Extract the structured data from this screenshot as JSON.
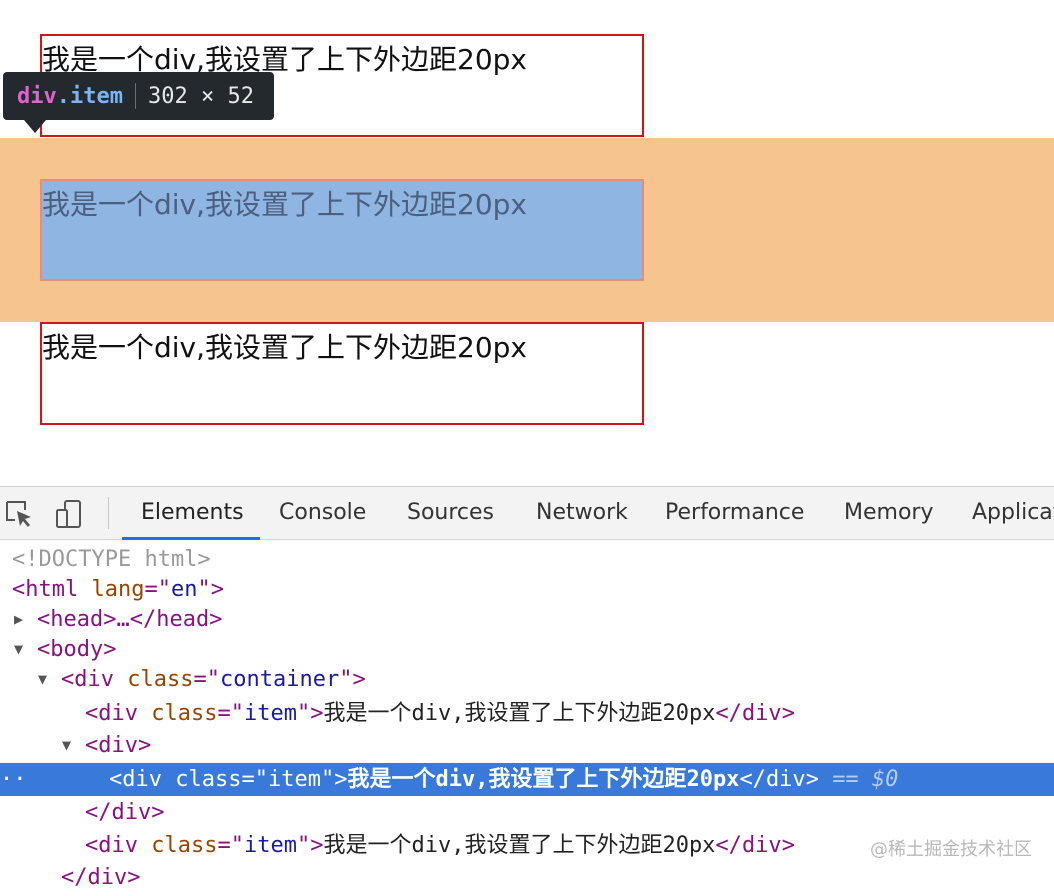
{
  "page": {
    "item_text": "我是一个div,我设置了上下外边距20px",
    "tooltip": {
      "tag": "div",
      "class": ".item",
      "size": "302 × 52"
    }
  },
  "devtools": {
    "tabs": [
      "Elements",
      "Console",
      "Sources",
      "Network",
      "Performance",
      "Memory",
      "Applicat"
    ],
    "active_tab": "Elements",
    "icons": [
      "inspect-element-icon",
      "device-toggle-icon"
    ],
    "dom": {
      "doctype": "<!DOCTYPE html>",
      "html_open": {
        "tag": "html",
        "attr": "lang",
        "val": "en"
      },
      "head": "<head>…</head>",
      "body_tag": "body",
      "container": {
        "tag": "div",
        "attr": "class",
        "val": "container"
      },
      "item_tag": "div",
      "item_attr": "class",
      "item_val": "item",
      "item_text": "我是一个div,我设置了上下外边距20px",
      "wrapper_open": "<div>",
      "wrapper_close": "</div>",
      "close_div": "</div>",
      "selected_marker": "== $0",
      "selected_dots": "··"
    },
    "watermark": "@稀土掘金技术社区"
  },
  "colors": {
    "border_red": "#d0151c",
    "margin_orange": "#f6c48f",
    "content_blue": "#8fb5e2",
    "selection_blue": "#3879d9",
    "tab_active": "#1a73e8"
  }
}
